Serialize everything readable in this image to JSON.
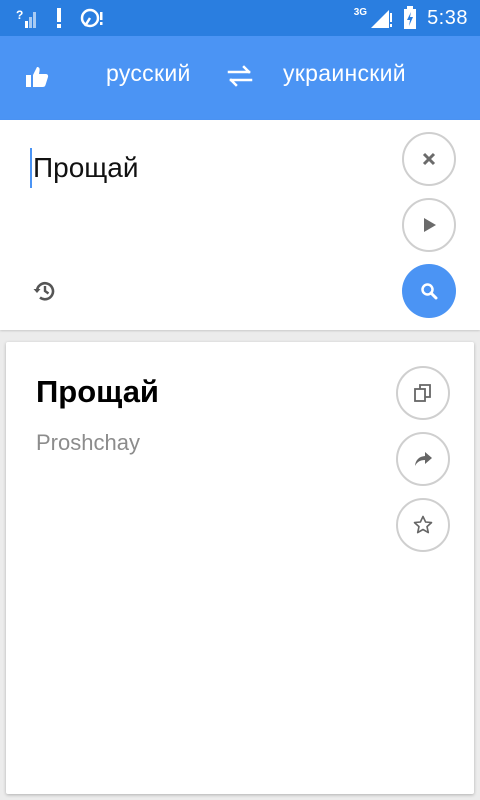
{
  "status_bar": {
    "time": "5:38",
    "network": "3G",
    "icons": [
      "signal-unknown-icon",
      "alert-icon",
      "usb-debug-icon",
      "cell-signal-icon",
      "battery-charging-icon"
    ]
  },
  "app_bar": {
    "source_language": "русский",
    "target_language": "украинский",
    "icons": [
      "thumbs-up-icon",
      "swap-icon"
    ]
  },
  "input": {
    "text": "Прощай",
    "icons": [
      "close-icon",
      "play-icon",
      "history-icon",
      "search-icon"
    ]
  },
  "result": {
    "word": "Прощай",
    "transliteration": "Proshchay",
    "icons": [
      "copy-icon",
      "share-icon",
      "star-icon"
    ]
  },
  "colors": {
    "status_bar": "#2a7ee0",
    "app_bar": "#4b94f4",
    "accent": "#4b94f4",
    "background": "#ececec",
    "transliteration": "#8c8c8c"
  }
}
